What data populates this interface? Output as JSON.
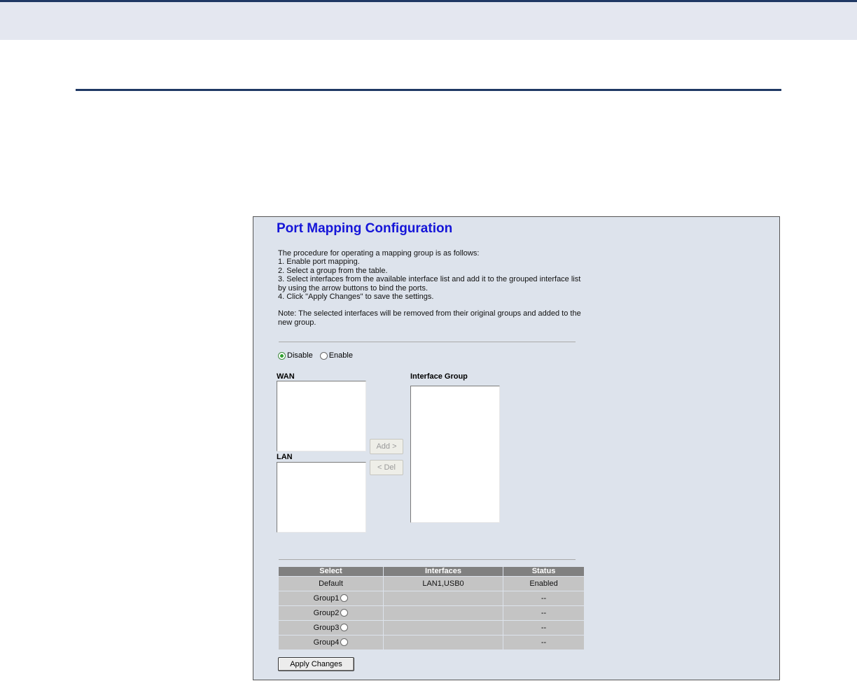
{
  "page": {
    "title": "Port Mapping Configuration",
    "instructions": [
      "The procedure for operating a mapping group is as follows:",
      "1. Enable port mapping.",
      "2. Select a group from the table.",
      "3. Select interfaces from the available interface list and add it to the grouped interface list",
      "by using the arrow buttons to bind the ports.",
      "4. Click \"Apply Changes\" to save the settings."
    ],
    "note": [
      "Note: The selected interfaces will be removed from their original groups and added to the",
      "new group."
    ]
  },
  "mode": {
    "selected": "Disable",
    "options": [
      {
        "label": "Disable",
        "checked": true
      },
      {
        "label": "Enable",
        "checked": false
      }
    ]
  },
  "lists": {
    "wan_label": "WAN",
    "lan_label": "LAN",
    "group_label": "Interface Group"
  },
  "buttons": {
    "add": "Add >",
    "del": "< Del",
    "apply": "Apply Changes"
  },
  "table": {
    "headers": [
      "Select",
      "Interfaces",
      "Status"
    ],
    "rows": [
      {
        "select": "Default",
        "interfaces": "LAN1,USB0",
        "status": "Enabled"
      },
      {
        "select": "Group1",
        "interfaces": "",
        "status": "--"
      },
      {
        "select": "Group2",
        "interfaces": "",
        "status": "--"
      },
      {
        "select": "Group3",
        "interfaces": "",
        "status": "--"
      },
      {
        "select": "Group4",
        "interfaces": "",
        "status": "--"
      }
    ]
  },
  "colors": {
    "title": "#1515d8",
    "panel_background": "#dde3ec",
    "table_header": "#808080",
    "table_cell": "#c4c4c4",
    "document_rule": "#1f3864"
  }
}
